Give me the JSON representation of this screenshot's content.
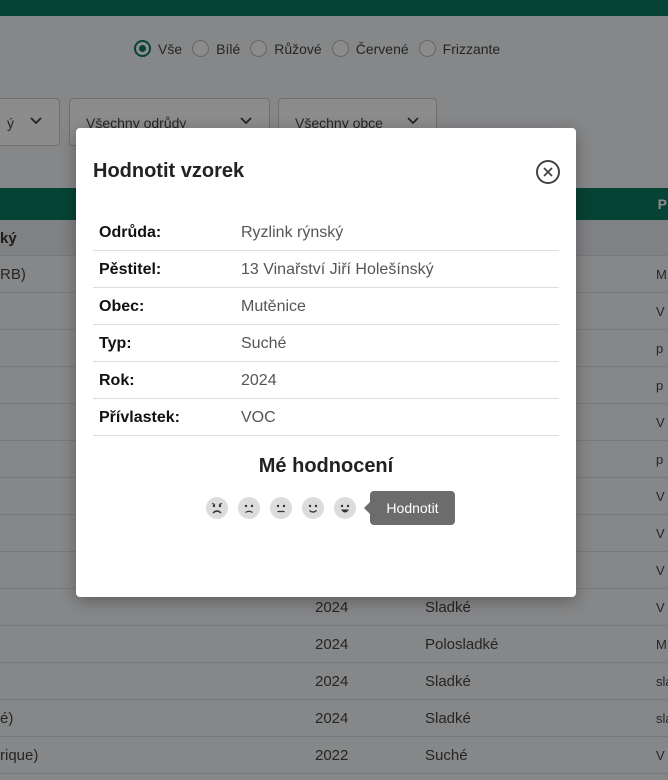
{
  "background": {
    "type_filter": {
      "options": [
        "Vše",
        "Bílé",
        "Růžové",
        "Červené",
        "Frizzante"
      ],
      "selected": "Vše"
    },
    "filters": {
      "first_partial": "ý",
      "varieties": "Všechny odrůdy",
      "villages": "Všechny obce"
    },
    "table": {
      "header_right": "P",
      "group_label": "ký",
      "rows": [
        {
          "c0": "RB)",
          "c1": "",
          "c2": "",
          "c3": "M"
        },
        {
          "c0": "",
          "c1": "",
          "c2": "",
          "c3": "V"
        },
        {
          "c0": "",
          "c1": "",
          "c2": "",
          "c3": "p"
        },
        {
          "c0": "",
          "c1": "",
          "c2": "",
          "c3": "p"
        },
        {
          "c0": "",
          "c1": "",
          "c2": "",
          "c3": "V"
        },
        {
          "c0": "",
          "c1": "",
          "c2": "",
          "c3": "p"
        },
        {
          "c0": "",
          "c1": "",
          "c2": "",
          "c3": "V"
        },
        {
          "c0": "",
          "c1": "",
          "c2": "",
          "c3": "V"
        },
        {
          "c0": "",
          "c1": "",
          "c2": "",
          "c3": "V"
        },
        {
          "c0": "",
          "c1": "2024",
          "c2": "Sladké",
          "c3": "V"
        },
        {
          "c0": "",
          "c1": "2024",
          "c2": "Polosladké",
          "c3": "M"
        },
        {
          "c0": "",
          "c1": "2024",
          "c2": "Sladké",
          "c3": "sla"
        },
        {
          "c0": "é)",
          "c1": "2024",
          "c2": "Sladké",
          "c3": "sla"
        },
        {
          "c0": "rique)",
          "c1": "2022",
          "c2": "Suché",
          "c3": "V"
        }
      ]
    }
  },
  "modal": {
    "title": "Hodnotit vzorek",
    "details": [
      {
        "label": "Odrůda:",
        "value": "Ryzlink rýnský"
      },
      {
        "label": "Pěstitel:",
        "value": "13 Vinařství Jiří Holešínský"
      },
      {
        "label": "Obec:",
        "value": "Mutěnice"
      },
      {
        "label": "Typ:",
        "value": "Suché"
      },
      {
        "label": "Rok:",
        "value": "2024"
      },
      {
        "label": "Přívlastek:",
        "value": "VOC"
      }
    ],
    "rating_title": "Mé hodnocení",
    "rating_icons": [
      "very-sad-face-icon",
      "sad-face-icon",
      "neutral-face-icon",
      "happy-face-icon",
      "very-happy-face-icon"
    ],
    "tooltip": "Hodnotit"
  },
  "colors": {
    "brand": "#0d7a5f",
    "tooltip_bg": "#6c6c6c"
  }
}
